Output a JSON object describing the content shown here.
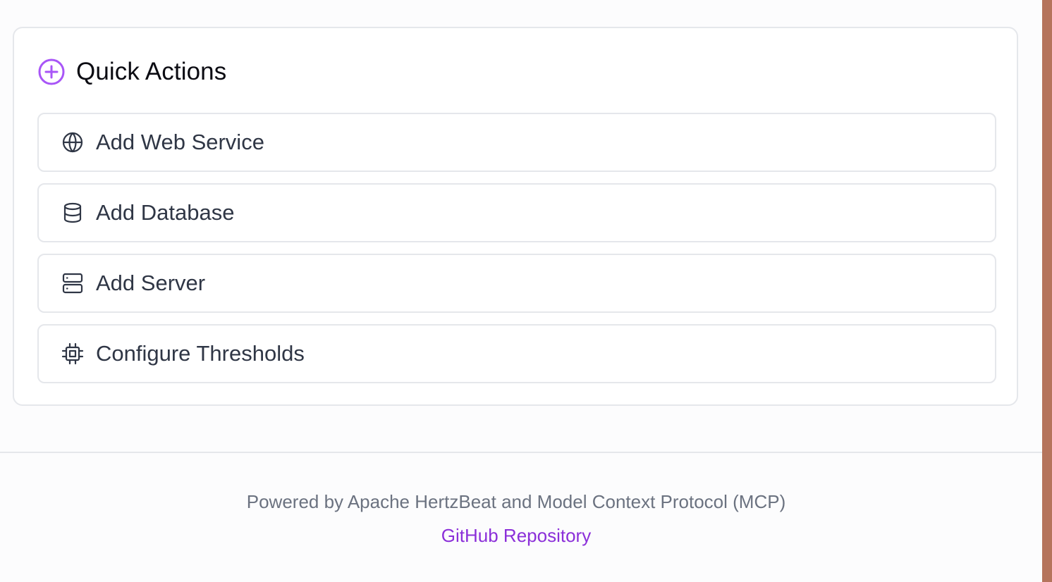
{
  "quick_actions": {
    "title": "Quick Actions",
    "icon": "plus-circle-icon",
    "accent_color": "#a855f7",
    "items": [
      {
        "label": "Add Web Service",
        "icon": "globe-icon"
      },
      {
        "label": "Add Database",
        "icon": "database-icon"
      },
      {
        "label": "Add Server",
        "icon": "server-icon"
      },
      {
        "label": "Configure Thresholds",
        "icon": "cpu-icon"
      }
    ]
  },
  "footer": {
    "powered_by": "Powered by Apache HertzBeat and Model Context Protocol (MCP)",
    "link_label": "GitHub Repository",
    "link_color": "#8b2fd9"
  }
}
